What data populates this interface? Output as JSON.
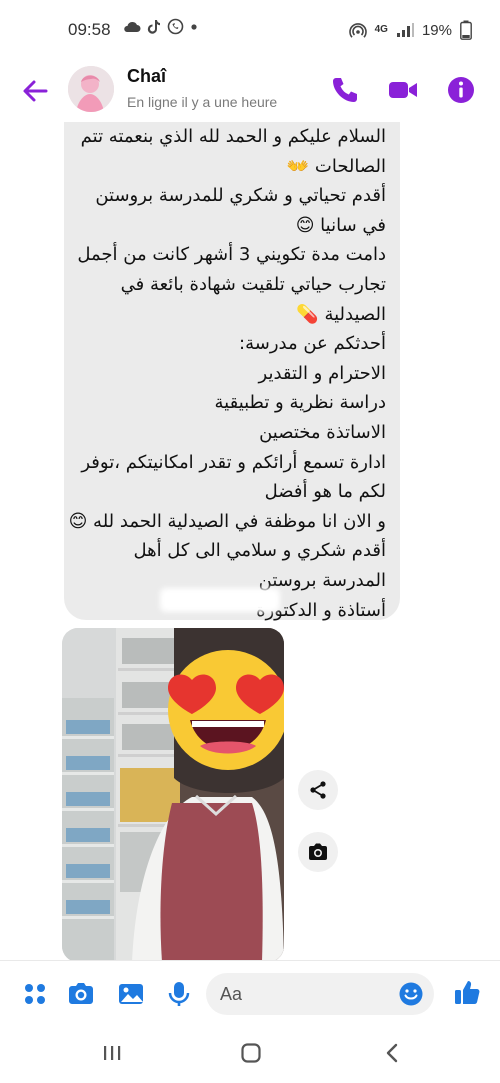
{
  "status_bar": {
    "time": "09:58",
    "battery": "19%",
    "network": "4G",
    "icons_left": [
      "cloud-icon",
      "tiktok-icon",
      "whatsapp-icon",
      "dot-icon"
    ],
    "icons_right": [
      "hotspot-icon",
      "network-4g-icon",
      "signal-icon",
      "battery-icon"
    ]
  },
  "header": {
    "contact_name": "Chaî",
    "contact_status": "En ligne il y a une heure",
    "accent_color": "#8a21d8"
  },
  "message": {
    "text": "السلام عليكم و الحمد لله الذي بنعمته تتم الصالحات 👐\nأقدم تحياتي و شكري للمدرسة بروستن في سانيا 😊\nدامت مدة تكويني 3 أشهر كانت من أجمل تجارب حياتي تلقيت شهادة بائعة في الصيدلية 💊\nأحدثكم عن مدرسة:\nالاحترام و التقدير\nدراسة نظرية و تطبيقية\nالاساتذة مختصين\nادارة تسمع أرائكم و تقدر امكانيتكم ،توفر لكم ما هو أفضل\nو الان انا موظفة في الصيدلية الحمد لله 😊\nأقدم شكري و سلامي الى كل أهل المدرسة بروستن\nأستاذة و الدكتورة"
  },
  "photo": {
    "emoji": "😍",
    "description_icon": "pharmacy-photo"
  },
  "actions": {
    "share_icon": "share-icon",
    "camera_icon": "camera-icon"
  },
  "composer": {
    "placeholder": "Aa"
  },
  "nav": {
    "recent_icon": "recent-apps-icon",
    "home_icon": "home-icon",
    "back_icon": "back-nav-icon"
  }
}
